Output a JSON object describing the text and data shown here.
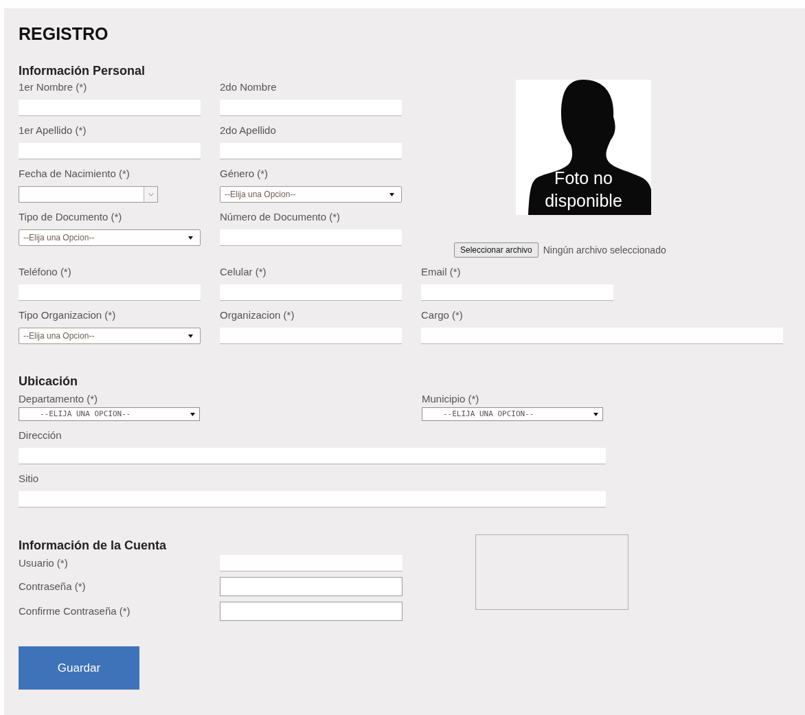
{
  "title": "REGISTRO",
  "personal": {
    "heading": "Información Personal",
    "rows": [
      [
        {
          "label": "1er Nombre (*)",
          "kind": "text"
        },
        {
          "label": "2do Nombre",
          "kind": "text"
        }
      ],
      [
        {
          "label": "1er Apellido (*)",
          "kind": "text"
        },
        {
          "label": "2do Apellido",
          "kind": "text"
        }
      ],
      [
        {
          "label": "Fecha de Nacimiento (*)",
          "kind": "date"
        },
        {
          "label": "Género (*)",
          "kind": "select",
          "value": "--Elija una Opcion--"
        }
      ],
      [
        {
          "label": "Tipo de Documento (*)",
          "kind": "select",
          "value": "--Elija una Opcion--"
        },
        {
          "label": "Número de Documento (*)",
          "kind": "text"
        }
      ]
    ],
    "photo": {
      "caption": "Foto no disponible"
    },
    "file": {
      "button": "Seleccionar archivo",
      "status": "Ningún archivo seleccionado"
    },
    "wide_rows": [
      [
        {
          "label": "Teléfono (*)",
          "kind": "text"
        },
        {
          "label": "Celular (*)",
          "kind": "text"
        },
        {
          "label": "Email (*)",
          "kind": "text"
        }
      ],
      [
        {
          "label": "Tipo Organizacion (*)",
          "kind": "select",
          "value": "--Elija una Opcion--"
        },
        {
          "label": "Organizacion (*)",
          "kind": "text"
        },
        {
          "label": "Cargo (*)",
          "kind": "wide"
        }
      ]
    ]
  },
  "location": {
    "heading": "Ubicación",
    "selects": [
      {
        "label": "Departamento (*)",
        "value": "--ELIJA UNA OPCION--"
      },
      {
        "label": "Municipio (*)",
        "value": "--ELIJA UNA OPCION--"
      }
    ],
    "fields": [
      {
        "label": "Dirección"
      },
      {
        "label": "Sitio"
      }
    ]
  },
  "account": {
    "heading": "Información de la Cuenta",
    "fields": [
      {
        "label": "Usuario (*)",
        "kind": "text"
      },
      {
        "label": "Contraseña (*)",
        "kind": "password"
      },
      {
        "label": "Confirme Contraseña (*)",
        "kind": "password"
      }
    ]
  },
  "save_button": "Guardar"
}
